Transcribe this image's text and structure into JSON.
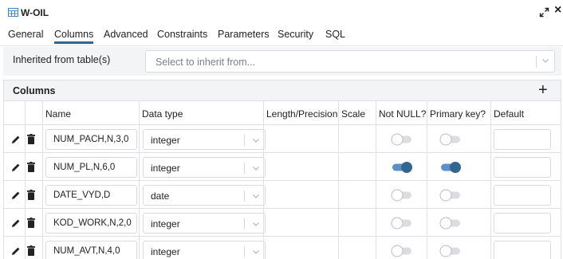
{
  "window": {
    "title": "W-OIL"
  },
  "tabs": [
    {
      "label": "General",
      "active": false
    },
    {
      "label": "Columns",
      "active": true
    },
    {
      "label": "Advanced",
      "active": false
    },
    {
      "label": "Constraints",
      "active": false
    },
    {
      "label": "Parameters",
      "active": false
    },
    {
      "label": "Security",
      "active": false
    },
    {
      "label": "SQL",
      "active": false
    }
  ],
  "inherit": {
    "label": "Inherited from table(s)",
    "placeholder": "Select to inherit from..."
  },
  "columns_section": {
    "title": "Columns",
    "add_label": "+",
    "headers": {
      "name": "Name",
      "data_type": "Data type",
      "length_precision": "Length/Precision",
      "scale": "Scale",
      "not_null": "Not NULL?",
      "primary_key": "Primary key?",
      "default": "Default"
    },
    "rows": [
      {
        "name": "NUM_PACH,N,3,0",
        "data_type": "integer",
        "not_null": false,
        "primary_key": false,
        "default": ""
      },
      {
        "name": "NUM_PL,N,6,0",
        "data_type": "integer",
        "not_null": true,
        "primary_key": true,
        "default": ""
      },
      {
        "name": "DATE_VYD,D",
        "data_type": "date",
        "not_null": false,
        "primary_key": false,
        "default": ""
      },
      {
        "name": "KOD_WORK,N,2,0",
        "data_type": "integer",
        "not_null": false,
        "primary_key": false,
        "default": ""
      },
      {
        "name": "NUM_AVT,N,4,0",
        "data_type": "integer",
        "not_null": false,
        "primary_key": false,
        "default": ""
      }
    ]
  },
  "colors": {
    "toggle_on_track": "#5b8fc8",
    "toggle_on_knob": "#326690",
    "toggle_off_track": "#dcdde0",
    "toggle_off_knob": "#ffffff",
    "active_tab_underline": "#326690",
    "title_icon": "#4a86c5"
  },
  "icons": {
    "title": "table-icon",
    "expand": "expand-icon",
    "close": "close-icon",
    "edit": "pencil-icon",
    "delete": "trash-icon",
    "chevron": "chevron-down-icon"
  }
}
